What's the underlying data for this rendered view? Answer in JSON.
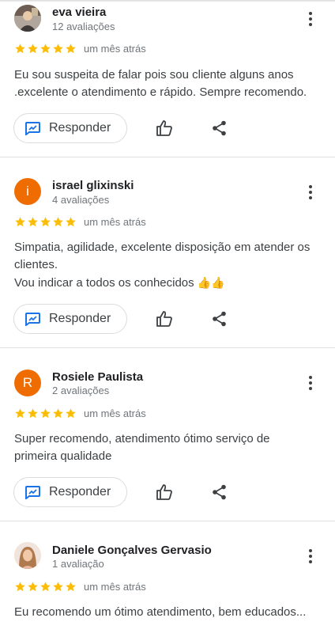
{
  "colors": {
    "star": "#fbbc04",
    "action_blue": "#1a73e8",
    "avatar_orange": "#ef6c00"
  },
  "icons": {
    "reply": "reply-icon",
    "like": "thumb-up-icon",
    "share": "share-icon",
    "more": "more-vert-icon",
    "star": "star-icon"
  },
  "reviews": [
    {
      "name": "eva vieira",
      "count": "12 avaliações",
      "rating": 5,
      "time": "um mês atrás",
      "text_lines": [
        "Eu sou suspeita de falar pois sou cliente alguns anos .excelente o atendimento e rápido. Sempre recomendo."
      ],
      "reply_label": "Responder",
      "avatar": {
        "type": "photo"
      }
    },
    {
      "name": "israel glixinski",
      "count": "4 avaliações",
      "rating": 5,
      "time": "um mês atrás",
      "text_lines": [
        "Simpatia, agilidade, excelente disposição em atender os clientes.",
        "Vou indicar a todos os conhecidos"
      ],
      "emoji": "👍👍",
      "reply_label": "Responder",
      "avatar": {
        "type": "letter",
        "letter": "i"
      }
    },
    {
      "name": "Rosiele Paulista",
      "count": "2 avaliações",
      "rating": 5,
      "time": "um mês atrás",
      "text_lines": [
        "Super recomendo, atendimento ótimo serviço de primeira qualidade"
      ],
      "reply_label": "Responder",
      "avatar": {
        "type": "letter",
        "letter": "R"
      }
    },
    {
      "name": "Daniele Gonçalves Gervasio",
      "count": "1 avaliação",
      "rating": 5,
      "time": "um mês atrás",
      "text_lines": [
        "Eu recomendo um ótimo atendimento, bem educados..."
      ],
      "avatar": {
        "type": "photo"
      }
    }
  ]
}
